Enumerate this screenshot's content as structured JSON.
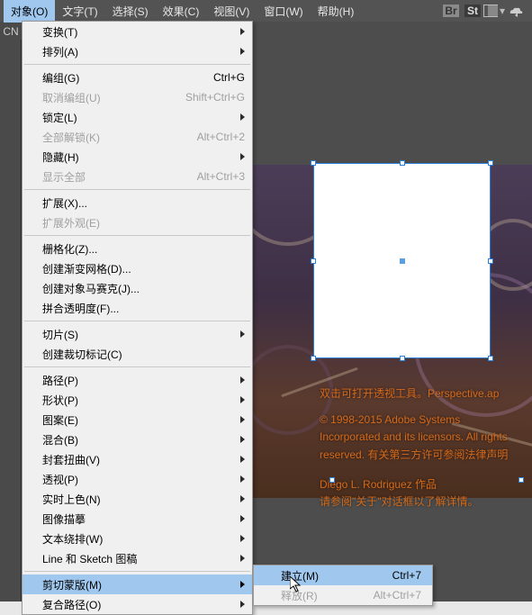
{
  "colors": {
    "accent": "#a0c8ef",
    "menubar_bg": "#535353",
    "panel_bg": "#f0f0f0"
  },
  "menubar": {
    "items": [
      {
        "label": "对象(O)",
        "active": true
      },
      {
        "label": "文字(T)"
      },
      {
        "label": "选择(S)"
      },
      {
        "label": "效果(C)"
      },
      {
        "label": "视图(V)"
      },
      {
        "label": "窗口(W)"
      },
      {
        "label": "帮助(H)"
      }
    ],
    "icons": [
      "br",
      "st",
      "layout",
      "cloud"
    ]
  },
  "sidebar_label": "CN",
  "dropdown": [
    {
      "label": "变换(T)",
      "submenu": true
    },
    {
      "label": "排列(A)",
      "submenu": true
    },
    {
      "sep": true
    },
    {
      "label": "编组(G)",
      "shortcut": "Ctrl+G"
    },
    {
      "label": "取消编组(U)",
      "shortcut": "Shift+Ctrl+G",
      "disabled": true
    },
    {
      "label": "锁定(L)",
      "submenu": true
    },
    {
      "label": "全部解锁(K)",
      "shortcut": "Alt+Ctrl+2",
      "disabled": true
    },
    {
      "label": "隐藏(H)",
      "submenu": true
    },
    {
      "label": "显示全部",
      "shortcut": "Alt+Ctrl+3",
      "disabled": true
    },
    {
      "sep": true
    },
    {
      "label": "扩展(X)..."
    },
    {
      "label": "扩展外观(E)",
      "disabled": true
    },
    {
      "sep": true
    },
    {
      "label": "栅格化(Z)..."
    },
    {
      "label": "创建渐变网格(D)..."
    },
    {
      "label": "创建对象马赛克(J)..."
    },
    {
      "label": "拼合透明度(F)..."
    },
    {
      "sep": true
    },
    {
      "label": "切片(S)",
      "submenu": true
    },
    {
      "label": "创建裁切标记(C)"
    },
    {
      "sep": true
    },
    {
      "label": "路径(P)",
      "submenu": true
    },
    {
      "label": "形状(P)",
      "submenu": true
    },
    {
      "label": "图案(E)",
      "submenu": true
    },
    {
      "label": "混合(B)",
      "submenu": true
    },
    {
      "label": "封套扭曲(V)",
      "submenu": true
    },
    {
      "label": "透视(P)",
      "submenu": true
    },
    {
      "label": "实时上色(N)",
      "submenu": true
    },
    {
      "label": "图像描摹",
      "submenu": true
    },
    {
      "label": "文本绕排(W)",
      "submenu": true
    },
    {
      "label": "Line 和 Sketch 图稿",
      "submenu": true
    },
    {
      "sep": true
    },
    {
      "label": "剪切蒙版(M)",
      "submenu": true,
      "highlight": true
    },
    {
      "label": "复合路径(O)",
      "submenu": true
    }
  ],
  "submenu": [
    {
      "label": "建立(M)",
      "shortcut": "Ctrl+7",
      "highlight": true
    },
    {
      "label": "释放(R)",
      "shortcut": "Alt+Ctrl+7",
      "disabled": true
    }
  ],
  "artwork_text": {
    "line1": "双击可打开透视工具。Perspective.ap",
    "line2": "© 1998-2015 Adobe Systems",
    "line3": "Incorporated and its licensors. All rights reserved. 有关第三方许可参阅法律声明",
    "line4": "Diego L. Rodriguez 作品",
    "line5": "请参阅\"关于\"对话框以了解详情。"
  }
}
